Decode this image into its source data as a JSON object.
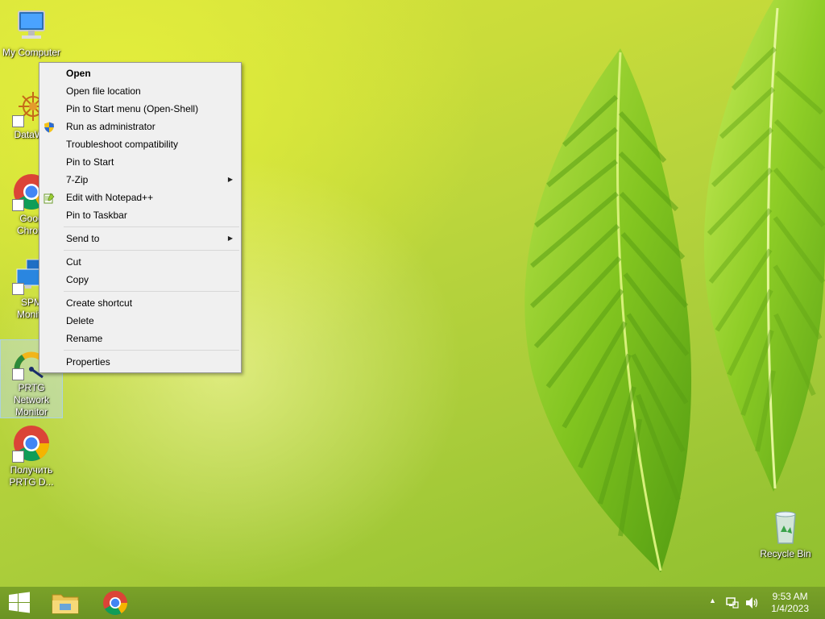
{
  "desktop_icons": [
    {
      "label": "My Computer",
      "icon": "computer-icon"
    },
    {
      "label": "DataWa",
      "icon": "datawarehouse-icon"
    },
    {
      "label": "Goog\nChrom",
      "icon": "chrome-icon"
    },
    {
      "label": "SPM\nMonito",
      "icon": "spm-monitor-icon"
    },
    {
      "label": "PRTG Network Monitor",
      "icon": "prtg-icon"
    },
    {
      "label": "Получить PRTG D...",
      "icon": "chrome-icon"
    }
  ],
  "recycle_bin": {
    "label": "Recycle Bin",
    "icon": "recycle-bin-icon"
  },
  "context_menu": {
    "groups": [
      [
        {
          "label": "Open",
          "bold": true
        },
        {
          "label": "Open file location"
        },
        {
          "label": "Pin to Start menu (Open-Shell)"
        },
        {
          "label": "Run as administrator",
          "icon": "uac-shield-icon"
        },
        {
          "label": "Troubleshoot compatibility"
        },
        {
          "label": "Pin to Start"
        },
        {
          "label": "7-Zip",
          "submenu": true
        },
        {
          "label": "Edit with Notepad++",
          "icon": "notepadpp-icon"
        },
        {
          "label": "Pin to Taskbar"
        }
      ],
      [
        {
          "label": "Send to",
          "submenu": true
        }
      ],
      [
        {
          "label": "Cut"
        },
        {
          "label": "Copy"
        }
      ],
      [
        {
          "label": "Create shortcut"
        },
        {
          "label": "Delete"
        },
        {
          "label": "Rename"
        }
      ],
      [
        {
          "label": "Properties"
        }
      ]
    ]
  },
  "taskbar": {
    "start_icon": "windows-logo-icon",
    "pinned": [
      {
        "name": "file-explorer",
        "icon": "folder-icon"
      },
      {
        "name": "chrome",
        "icon": "chrome-icon"
      }
    ],
    "tray": {
      "time": "9:53 AM",
      "date": "1/4/2023",
      "icons": [
        "show-hidden-icons-chevron",
        "network-icon",
        "volume-icon"
      ]
    }
  },
  "colors": {
    "menu_bg": "#f0f0f0",
    "menu_border": "#979797",
    "taskbar": "#78a028"
  }
}
